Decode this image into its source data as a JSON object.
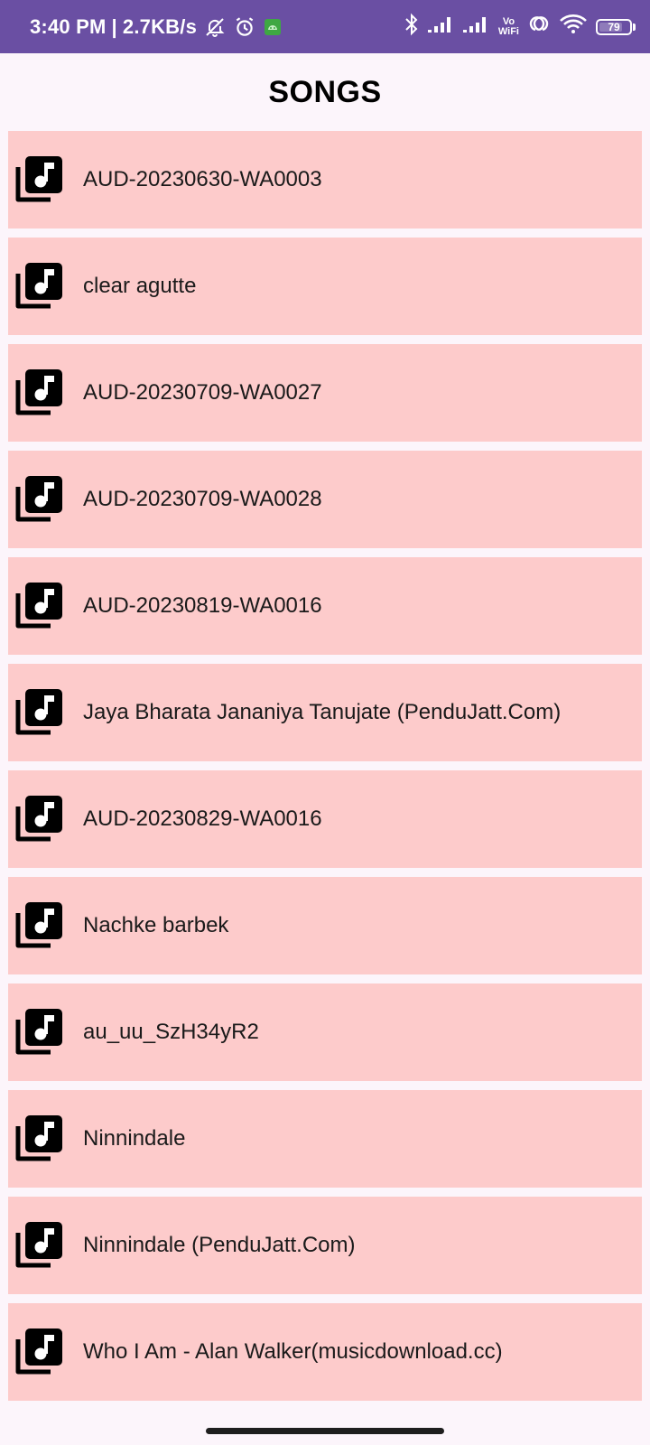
{
  "status_bar": {
    "time": "3:40 PM",
    "separator": "|",
    "network_speed": "2.7KB/s",
    "vowifi_top": "Vo",
    "vowifi_bottom": "WiFi",
    "battery_level": "79",
    "battery_fraction": 0.79,
    "icons": [
      "muted-bell-icon",
      "alarm-icon",
      "android-app-icon",
      "bluetooth-icon",
      "signal-1-icon",
      "signal-2-icon",
      "vowifi-icon",
      "hotspot-icon",
      "wifi-icon",
      "battery-icon"
    ],
    "background": "#6a4fa3"
  },
  "header": {
    "title": "SONGS"
  },
  "songs": [
    {
      "title": "AUD-20230630-WA0003",
      "icon": "music-library-icon"
    },
    {
      "title": "clear agutte",
      "icon": "music-library-icon"
    },
    {
      "title": "AUD-20230709-WA0027",
      "icon": "music-library-icon"
    },
    {
      "title": "AUD-20230709-WA0028",
      "icon": "music-library-icon"
    },
    {
      "title": "AUD-20230819-WA0016",
      "icon": "music-library-icon"
    },
    {
      "title": "Jaya Bharata Jananiya Tanujate (PenduJatt.Com)",
      "icon": "music-library-icon"
    },
    {
      "title": "AUD-20230829-WA0016",
      "icon": "music-library-icon"
    },
    {
      "title": "Nachke barbek",
      "icon": "music-library-icon"
    },
    {
      "title": "au_uu_SzH34yR2",
      "icon": "music-library-icon"
    },
    {
      "title": "Ninnindale",
      "icon": "music-library-icon"
    },
    {
      "title": "Ninnindale  (PenduJatt.Com)",
      "icon": "music-library-icon"
    },
    {
      "title": "Who I Am - Alan Walker(musicdownload.cc)",
      "icon": "music-library-icon"
    }
  ],
  "colors": {
    "item_background": "#fdcbcb",
    "page_background": "#fcf5fb",
    "text": "#1a1a1a"
  }
}
